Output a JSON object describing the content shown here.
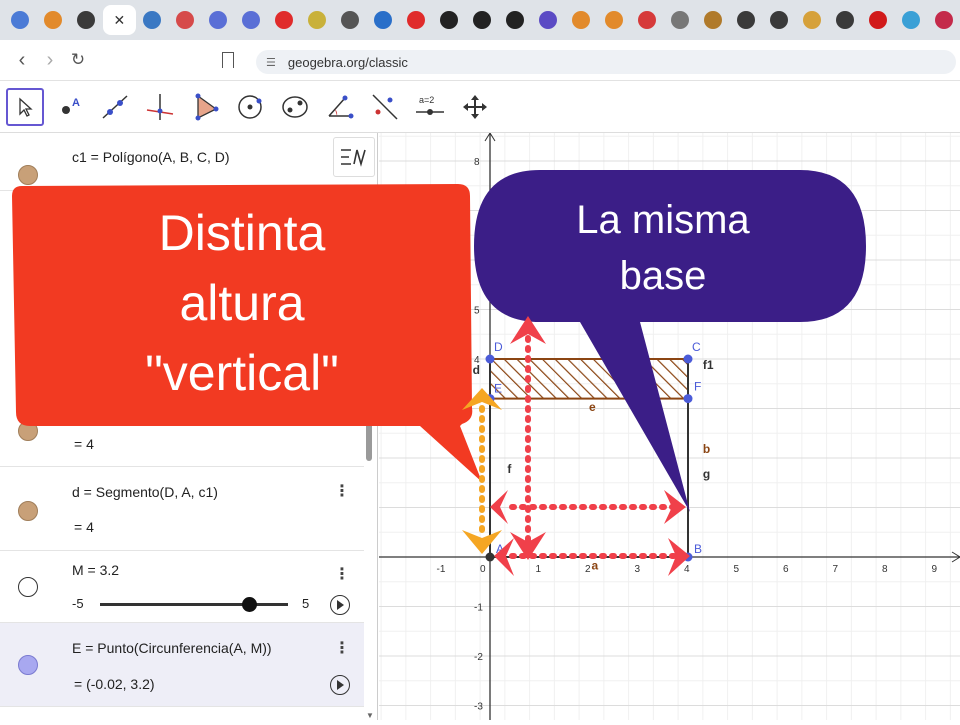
{
  "browser": {
    "url": "geogebra.org/classic",
    "tabs": [
      {
        "icon": "tab-favicon-check",
        "color": "#4b7bd6"
      },
      {
        "icon": "tab-favicon-orange-ring",
        "color": "#e28a2b"
      },
      {
        "icon": "tab-favicon-dark-globe",
        "color": "#3a3a3a"
      },
      {
        "icon": "tab-favicon-close",
        "color": "#333333",
        "active": true
      },
      {
        "icon": "tab-favicon-blue-bird",
        "color": "#3a78c3"
      },
      {
        "icon": "tab-favicon-red-pin",
        "color": "#d64a4a"
      },
      {
        "icon": "tab-favicon-slides",
        "color": "#5a6fd6"
      },
      {
        "icon": "tab-favicon-slides2",
        "color": "#5a6fd6"
      },
      {
        "icon": "tab-favicon-youtube",
        "color": "#e02b2b"
      },
      {
        "icon": "tab-favicon-yellow",
        "color": "#c9b13a"
      },
      {
        "icon": "tab-favicon-vx",
        "color": "#555555"
      },
      {
        "icon": "tab-favicon-play",
        "color": "#2a6fc9"
      },
      {
        "icon": "tab-favicon-youtube2",
        "color": "#e02b2b"
      },
      {
        "icon": "tab-favicon-chatgpt",
        "color": "#222222"
      },
      {
        "icon": "tab-favicon-chatgpt2",
        "color": "#222222"
      },
      {
        "icon": "tab-favicon-chatgpt3",
        "color": "#222222"
      },
      {
        "icon": "tab-favicon-mail",
        "color": "#5b4bc4"
      },
      {
        "icon": "tab-favicon-orange-ring2",
        "color": "#e28a2b"
      },
      {
        "icon": "tab-favicon-orange-ring3",
        "color": "#e28a2b"
      },
      {
        "icon": "tab-favicon-red-box",
        "color": "#d63a3a"
      },
      {
        "icon": "tab-favicon-wiki",
        "color": "#777777"
      },
      {
        "icon": "tab-favicon-fn",
        "color": "#b07a2a"
      },
      {
        "icon": "tab-favicon-dark-globe2",
        "color": "#3a3a3a"
      },
      {
        "icon": "tab-favicon-dark-globe3",
        "color": "#3a3a3a"
      },
      {
        "icon": "tab-favicon-mountain",
        "color": "#d6a13a"
      },
      {
        "icon": "tab-favicon-dark-globe4",
        "color": "#3a3a3a"
      },
      {
        "icon": "tab-favicon-netflix",
        "color": "#d11a1a"
      },
      {
        "icon": "tab-favicon-windows",
        "color": "#3aa0d6"
      },
      {
        "icon": "tab-favicon-raspberry",
        "color": "#c42a4a"
      }
    ]
  },
  "toolbar": {
    "tools": [
      "move-tool-icon",
      "point-tool-icon",
      "line-tool-icon",
      "perpendicular-tool-icon",
      "polygon-tool-icon",
      "circle-tool-icon",
      "conic-tool-icon",
      "angle-tool-icon",
      "reflect-tool-icon",
      "slider-tool-icon",
      "move-view-tool-icon"
    ],
    "slider_tool_label": "a=2"
  },
  "algebra": {
    "menu_icon": "algebra-menu-icon",
    "rows": [
      {
        "line1": "c1  =  Polígono(A, B, C, D)",
        "color": "#c8a078"
      },
      {
        "line2": "=  4",
        "color": "#c8a078"
      },
      {
        "line1": "d  =  Segmento(D, A, c1)",
        "line2": "=  4",
        "color": "#c8a078"
      },
      {
        "line1": "M = 3.2",
        "slider_min": "-5",
        "slider_max": "5",
        "slider_value": 0.82,
        "color": "#ffffff"
      },
      {
        "line1": "E  =  Punto(Circunferencia(A, M))",
        "line2": "=  (-0.02, 3.2)",
        "color": "#a8a8f0"
      }
    ]
  },
  "graphics": {
    "x_ticks": [
      "-1",
      "0",
      "1",
      "2",
      "3",
      "4",
      "5",
      "6",
      "7",
      "8",
      "9"
    ],
    "y_ticks": [
      "8",
      "5",
      "4",
      "-1",
      "-2",
      "-3"
    ],
    "point_labels": [
      "A",
      "B",
      "C",
      "D",
      "E",
      "F"
    ],
    "object_labels": [
      "a",
      "b",
      "d",
      "e",
      "f",
      "g",
      "f1"
    ],
    "colors": {
      "polygon_stroke": "#8b4513",
      "point": "#4b5bd8",
      "grid": "#e3e3e3",
      "axis": "#333333"
    }
  },
  "overlays": {
    "red_callout": {
      "text": "Distinta\naltura\n\"vertical\"",
      "color": "#f23a22"
    },
    "purple_callout": {
      "text": "La misma\nbase",
      "color": "#3b1e87"
    },
    "arrow_colors": {
      "red": "#f0404a",
      "orange": "#f5a623"
    }
  }
}
